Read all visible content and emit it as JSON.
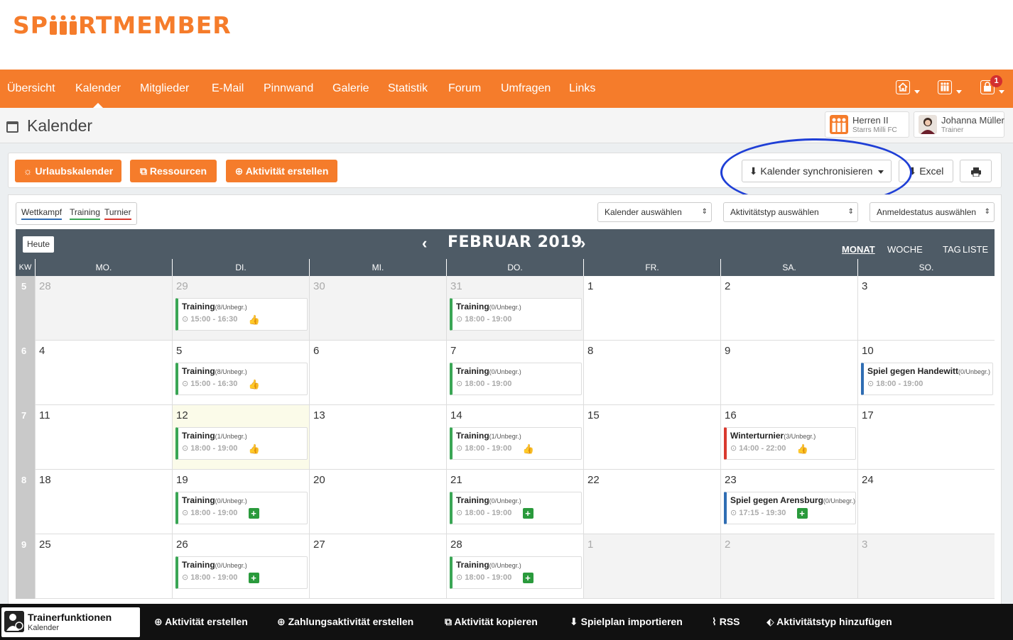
{
  "app": {
    "logo_a": "SP",
    "logo_b": "RTMEMBER"
  },
  "nav": {
    "items": [
      "Übersicht",
      "Kalender",
      "Mitglieder",
      "E-Mail",
      "Pinnwand",
      "Galerie",
      "Statistik",
      "Forum",
      "Umfragen",
      "Links"
    ],
    "active": "Kalender",
    "notification_count": "1"
  },
  "page": {
    "title": "Kalender"
  },
  "team": {
    "name": "Herren II",
    "club": "Starrs Milli FC"
  },
  "user": {
    "name": "Johanna Müller",
    "role": "Trainer"
  },
  "toolbar": {
    "vacation": "Urlaubskalender",
    "resources": "Ressourcen",
    "create": "Aktivität erstellen",
    "sync": "Kalender synchronisieren",
    "excel": "Excel"
  },
  "legend": {
    "comp": "Wettkampf",
    "training": "Training",
    "tournament": "Turnier"
  },
  "filters": {
    "calendar": "Kalender auswählen",
    "type": "Aktivitätstyp auswählen",
    "status": "Anmeldestatus auswählen"
  },
  "calendar": {
    "today": "Heute",
    "month": "FEBRUAR 2019",
    "views": [
      "MONAT",
      "WOCHE",
      "TAG",
      "LISTE"
    ],
    "kw_label": "KW",
    "days": [
      "MO.",
      "DI.",
      "MI.",
      "DO.",
      "FR.",
      "SA.",
      "SO."
    ],
    "weeks": [
      {
        "kw": "5",
        "days": [
          "28",
          "29",
          "30",
          "31",
          "1",
          "2",
          "3"
        ]
      },
      {
        "kw": "6",
        "days": [
          "4",
          "5",
          "6",
          "7",
          "8",
          "9",
          "10"
        ]
      },
      {
        "kw": "7",
        "days": [
          "11",
          "12",
          "13",
          "14",
          "15",
          "16",
          "17"
        ]
      },
      {
        "kw": "8",
        "days": [
          "18",
          "19",
          "20",
          "21",
          "22",
          "23",
          "24"
        ]
      },
      {
        "kw": "9",
        "days": [
          "25",
          "26",
          "27",
          "28",
          "1",
          "2",
          "3"
        ]
      }
    ],
    "events": [
      {
        "title": "Training",
        "count": "(8/Unbegr.)",
        "time": "15:00 - 16:30"
      },
      {
        "title": "Training",
        "count": "(0/Unbegr.)",
        "time": "18:00 - 19:00"
      },
      {
        "title": "Training",
        "count": "(8/Unbegr.)",
        "time": "15:00 - 16:30"
      },
      {
        "title": "Training",
        "count": "(0/Unbegr.)",
        "time": "18:00 - 19:00"
      },
      {
        "title": "Spiel gegen Handewitt",
        "count": "(0/Unbegr.)",
        "time": "18:00 - 19:00"
      },
      {
        "title": "Training",
        "count": "(1/Unbegr.)",
        "time": "18:00 - 19:00"
      },
      {
        "title": "Training",
        "count": "(1/Unbegr.)",
        "time": "18:00 - 19:00"
      },
      {
        "title": "Winterturnier",
        "count": "(3/Unbegr.)",
        "time": "14:00 - 22:00"
      },
      {
        "title": "Training",
        "count": "(0/Unbegr.)",
        "time": "18:00 - 19:00"
      },
      {
        "title": "Training",
        "count": "(0/Unbegr.)",
        "time": "18:00 - 19:00"
      },
      {
        "title": "Spiel gegen Arensburg",
        "count": "(0/Unbegr.)",
        "time": "17:15 - 19:30"
      },
      {
        "title": "Training",
        "count": "(0/Unbegr.)",
        "time": "18:00 - 19:00"
      },
      {
        "title": "Training",
        "count": "(0/Unbegr.)",
        "time": "18:00 - 19:00"
      }
    ]
  },
  "footer": {
    "trainer_title": "Trainerfunktionen",
    "trainer_sub": "Kalender",
    "items": [
      "Aktivität erstellen",
      "Zahlungsaktivität erstellen",
      "Aktivität kopieren",
      "Spielplan importieren",
      "RSS",
      "Aktivitätstyp hinzufügen"
    ]
  },
  "colors": {
    "brand": "#f57c2b",
    "training": "#3aa655",
    "competition": "#2f6db3",
    "tournament": "#d9392f",
    "header": "#4e5b66"
  }
}
